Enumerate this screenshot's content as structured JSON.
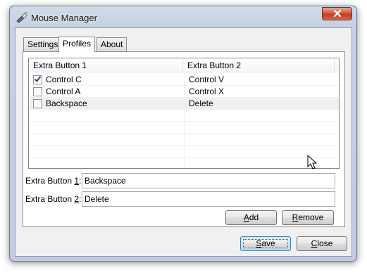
{
  "window": {
    "title": "Mouse Manager",
    "close_label": "✕"
  },
  "tabs": [
    {
      "label": "Settings",
      "active": false
    },
    {
      "label": "Profiles",
      "active": true
    },
    {
      "label": "About",
      "active": false
    }
  ],
  "list": {
    "columns": [
      "Extra Button 1",
      "Extra Button 2"
    ],
    "rows": [
      {
        "button1": "Control C",
        "button2": "Control V",
        "checked": true,
        "selected": false
      },
      {
        "button1": "Control A",
        "button2": "Control X",
        "checked": false,
        "selected": false
      },
      {
        "button1": "Backspace",
        "button2": "Delete",
        "checked": false,
        "selected": true
      }
    ]
  },
  "fields": {
    "button1": {
      "label_prefix": "Extra Button ",
      "label_accel": "1",
      "label_suffix": ":",
      "value": "Backspace"
    },
    "button2": {
      "label_prefix": "Extra Button ",
      "label_accel": "2",
      "label_suffix": ":",
      "value": "Delete"
    }
  },
  "buttons": {
    "add": {
      "accel": "A",
      "rest": "dd"
    },
    "remove": {
      "accel": "R",
      "rest": "emove"
    },
    "save": {
      "accel": "S",
      "rest": "ave"
    },
    "close": {
      "accel": "C",
      "rest": "lose"
    }
  },
  "colors": {
    "window_frame": "#c4d2e2",
    "close_button": "#c23a22",
    "selected_row": "#f0f0f0",
    "default_button_border": "#3c7fb1"
  },
  "icons": {
    "app": "mouse-icon",
    "checkbox_checked": "checkmark-icon",
    "cursor": "arrow-cursor-icon"
  }
}
